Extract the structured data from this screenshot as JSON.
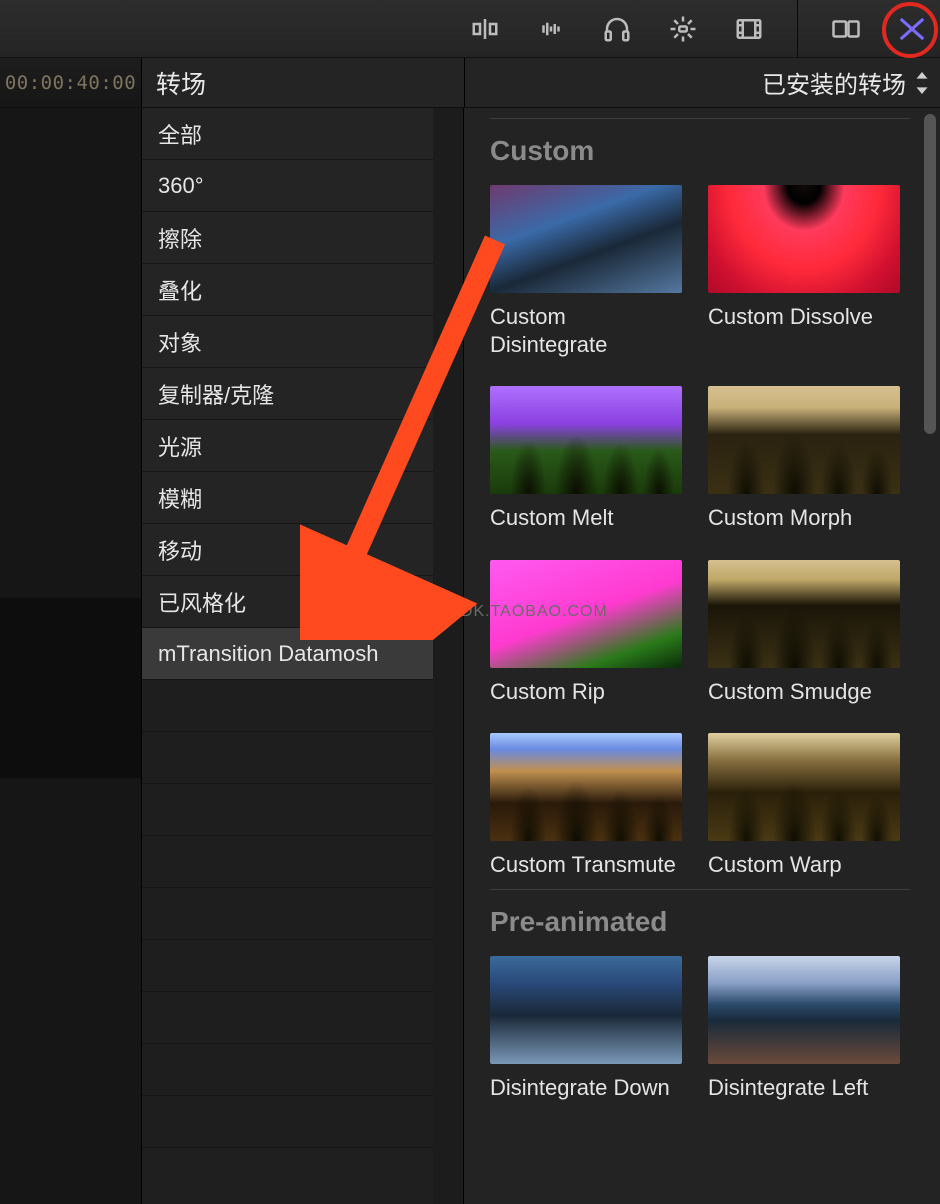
{
  "toolbar": {
    "icons": [
      "align-icon",
      "waveform-icon",
      "headphones-icon",
      "enhance-icon",
      "filmstrip-icon",
      "compare-icon",
      "transitions-icon"
    ]
  },
  "timecode": "00:00:40:00",
  "panel_title": "转场",
  "filter_dropdown": "已安装的转场",
  "categories": [
    "全部",
    "360°",
    "擦除",
    "叠化",
    "对象",
    "复制器/克隆",
    "光源",
    "模糊",
    "移动",
    "已风格化",
    "mTransition Datamosh"
  ],
  "selected_category_index": 10,
  "sections": [
    {
      "title": "Custom",
      "items": [
        {
          "label": "Custom Disintegrate",
          "art": "art-disintegrate"
        },
        {
          "label": "Custom Dissolve",
          "art": "art-dissolve"
        },
        {
          "label": "Custom Melt",
          "art": "art-melt trees"
        },
        {
          "label": "Custom Morph",
          "art": "art-morph trees"
        },
        {
          "label": "Custom Rip",
          "art": "art-rip"
        },
        {
          "label": "Custom Smudge",
          "art": "art-smudge trees"
        },
        {
          "label": "Custom Transmute",
          "art": "art-transmute trees"
        },
        {
          "label": "Custom Warp",
          "art": "art-warp trees"
        }
      ]
    },
    {
      "title": "Pre-animated",
      "items": [
        {
          "label": "Disintegrate Down",
          "art": "art-ddown"
        },
        {
          "label": "Disintegrate Left",
          "art": "art-dleft"
        }
      ]
    }
  ],
  "watermark": "早道大咖  IAMDK.TAOBAO.COM"
}
